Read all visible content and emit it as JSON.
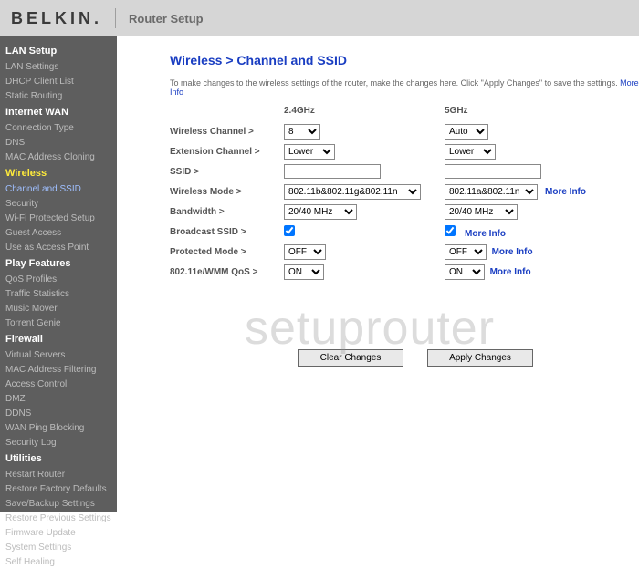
{
  "header": {
    "brand": "BELKIN",
    "title": "Router Setup"
  },
  "sidebar": {
    "groups": [
      {
        "head": "LAN Setup",
        "items": [
          "LAN Settings",
          "DHCP Client List",
          "Static Routing"
        ]
      },
      {
        "head": "Internet WAN",
        "items": [
          "Connection Type",
          "DNS",
          "MAC Address Cloning"
        ]
      },
      {
        "head": "Wireless",
        "wireless": true,
        "items": [
          "Channel and SSID",
          "Security",
          "Wi-Fi Protected Setup",
          "Guest Access",
          "Use as Access Point"
        ]
      },
      {
        "head": "Play Features",
        "items": [
          "QoS Profiles",
          "Traffic Statistics",
          "Music Mover",
          "Torrent Genie"
        ]
      },
      {
        "head": "Firewall",
        "items": [
          "Virtual Servers",
          "MAC Address Filtering",
          "Access Control",
          "DMZ",
          "DDNS",
          "WAN Ping Blocking",
          "Security Log"
        ]
      },
      {
        "head": "Utilities",
        "items": [
          "Restart Router",
          "Restore Factory Defaults",
          "Save/Backup Settings",
          "Restore Previous Settings",
          "Firmware Update",
          "System Settings",
          "Self Healing"
        ]
      }
    ],
    "active": "Channel and SSID"
  },
  "page": {
    "title": "Wireless > Channel and SSID",
    "desc": "To make changes to the wireless settings of the router, make the changes here. Click \"Apply Changes\" to save the settings.",
    "more_info": "More Info",
    "cols": {
      "c1": "2.4GHz",
      "c2": "5GHz"
    },
    "rows": {
      "channel": {
        "label": "Wireless Channel >",
        "v24": "8",
        "v5": "Auto"
      },
      "ext": {
        "label": "Extension Channel >",
        "v24": "Lower",
        "v5": "Lower"
      },
      "ssid": {
        "label": "SSID >",
        "v24": "",
        "v5": ""
      },
      "mode": {
        "label": "Wireless Mode >",
        "v24": "802.11b&802.11g&802.11n",
        "v5": "802.11a&802.11n",
        "mi": true
      },
      "bw": {
        "label": "Bandwidth >",
        "v24": "20/40 MHz",
        "v5": "20/40 MHz"
      },
      "broadcast": {
        "label": "Broadcast SSID >",
        "v24": true,
        "v5": true,
        "mi": true
      },
      "protected": {
        "label": "Protected Mode >",
        "v24": "OFF",
        "v5": "OFF",
        "mi": true
      },
      "qos": {
        "label": "802.11e/WMM QoS >",
        "v24": "ON",
        "v5": "ON",
        "mi": true
      }
    },
    "buttons": {
      "clear": "Clear Changes",
      "apply": "Apply Changes"
    },
    "watermark": "setuprouter"
  }
}
